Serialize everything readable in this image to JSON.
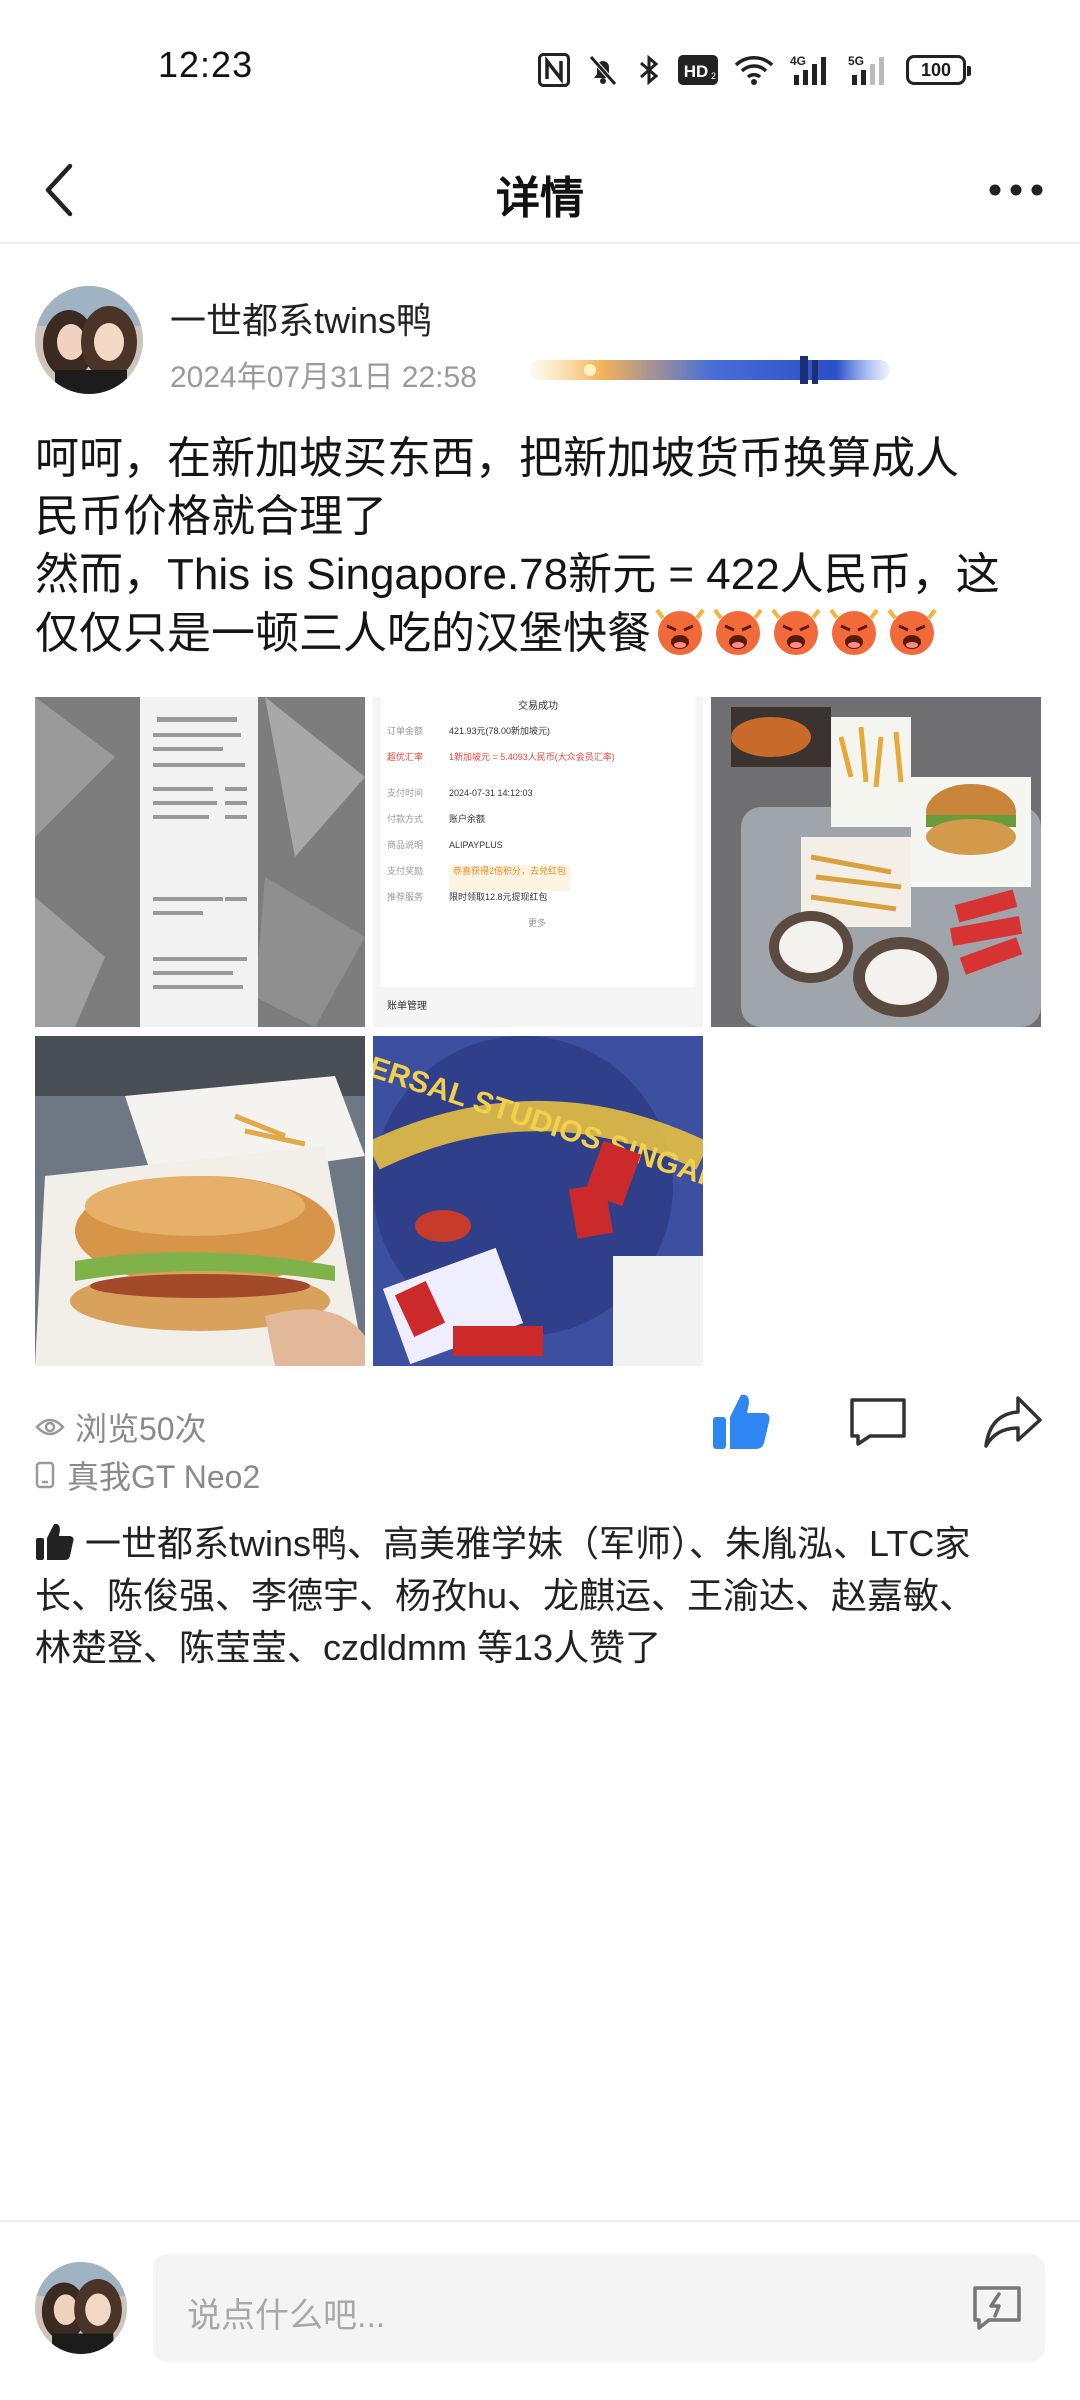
{
  "status_bar": {
    "time": "12:23",
    "battery": "100",
    "icons": [
      "nfc-icon",
      "mute-bell-icon",
      "bluetooth-icon",
      "hd-icon",
      "wifi-icon",
      "signal-4g-icon",
      "signal-5g-icon",
      "battery-icon"
    ],
    "hd_label": "HD",
    "net1": "4G",
    "net2": "5G"
  },
  "header": {
    "title": "详情"
  },
  "author": {
    "name": "一世都系twins鸭",
    "time": "2024年07月31日 22:58"
  },
  "post": {
    "lines": [
      "呵呵，在新加坡买东西，把新加坡货币换算成人",
      "民币价格就合理了",
      "然而，This is Singapore.78新元 = 422人民币，这",
      "仅仅只是一顿三人吃的汉堡快餐"
    ],
    "emoji_count": 5
  },
  "receipt": {
    "title": "交易成功",
    "rows": [
      {
        "k": "订单金额",
        "v": "421.93元(78.00新加坡元)"
      },
      {
        "k": "超优汇率",
        "v": "1新加坡元 = 5.4093人民币(大众会员汇率)"
      },
      {
        "k": "支付时间",
        "v": "2024-07-31 14:12:03"
      },
      {
        "k": "付款方式",
        "v": "账户余额"
      },
      {
        "k": "商品说明",
        "v": "ALIPAYPLUS"
      },
      {
        "k": "支付奖励",
        "v": "恭喜获得2倍积分，去兑红包"
      },
      {
        "k": "推荐服务",
        "v": "限时领取12.8元提现红包"
      }
    ],
    "more": "更多",
    "footer": "账单管理"
  },
  "poster_text": "UNIVERSAL STUDIOS SINGAPORE",
  "meta": {
    "views": "浏览50次",
    "device": "真我GT Neo2"
  },
  "likes": {
    "lines": [
      "一世都系twins鸭、高美雅学妹（军师）、朱胤泓、LTC家",
      "长、陈俊强、李德宇、杨孜hu、龙麒运、王渝达、赵嘉敏、",
      "林楚登、陈莹莹、czdldmm 等13人赞了"
    ]
  },
  "comment": {
    "placeholder": "说点什么吧..."
  }
}
